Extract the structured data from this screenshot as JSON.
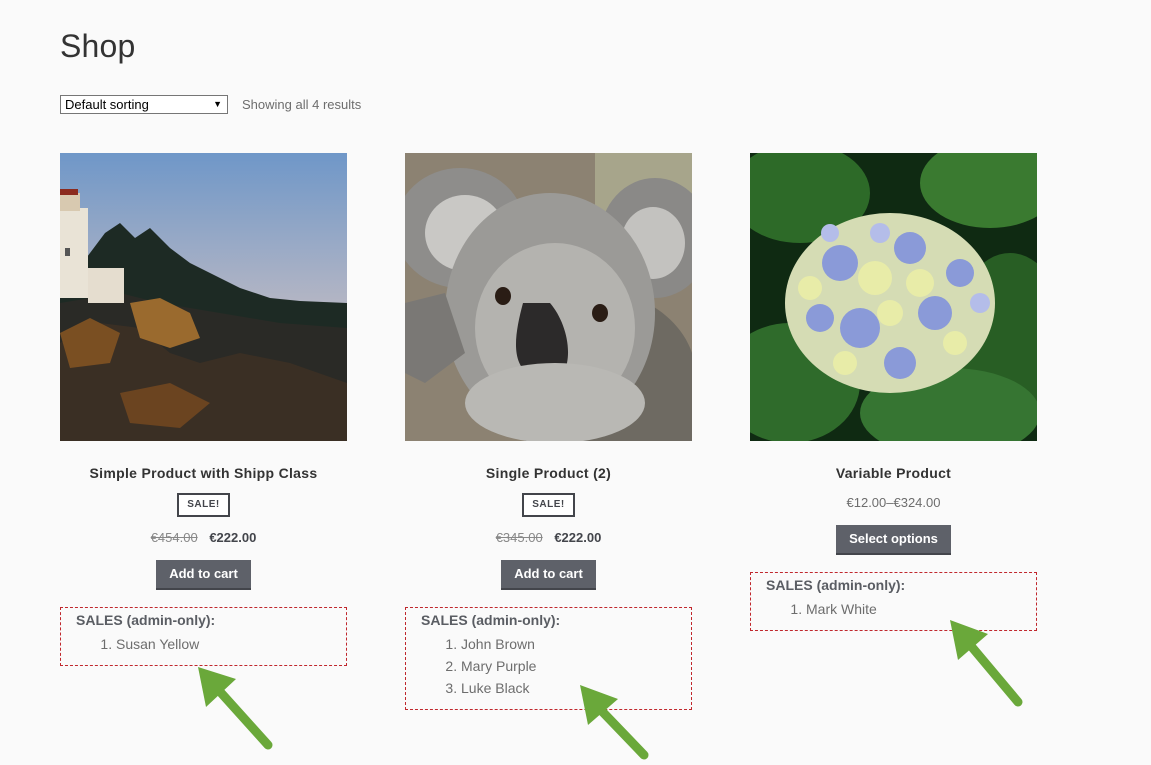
{
  "page": {
    "title": "Shop"
  },
  "toolbar": {
    "sorting_selected": "Default sorting",
    "results_count": "Showing all 4 results"
  },
  "products": [
    {
      "title": "Simple Product with Shipp Class",
      "badge": "SALE!",
      "old_price": "€454.00",
      "price": "€222.00",
      "button": "Add to cart",
      "image": "lighthouse-coast-image",
      "sales_title": "SALES (admin-only):",
      "sales": [
        "Susan Yellow"
      ]
    },
    {
      "title": "Single Product (2)",
      "badge": "SALE!",
      "old_price": "€345.00",
      "price": "€222.00",
      "button": "Add to cart",
      "image": "koala-image",
      "sales_title": "SALES (admin-only):",
      "sales": [
        "John Brown",
        "Mary Purple",
        "Luke Black"
      ]
    },
    {
      "title": "Variable Product",
      "price_range": "€12.00–€324.00",
      "button": "Select options",
      "image": "hydrangea-image",
      "sales_title": "SALES (admin-only):",
      "sales": [
        "Mark White"
      ]
    }
  ],
  "colors": {
    "button_bg": "#5e6169",
    "annotation_arrow": "#6aa83a",
    "sales_border": "#c0272d"
  }
}
